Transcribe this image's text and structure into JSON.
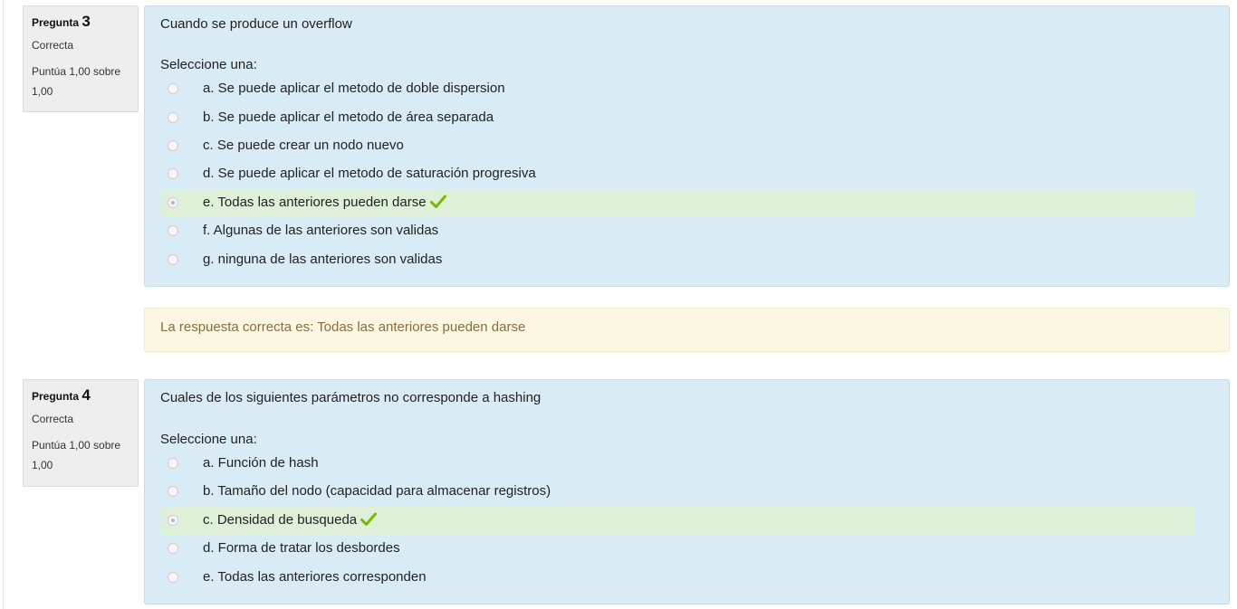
{
  "questions": [
    {
      "qlabel": "Pregunta",
      "number": "3",
      "state": "Correcta",
      "grade": "Puntúa 1,00 sobre 1,00",
      "text": "Cuando se produce un overflow",
      "prompt": "Seleccione una:",
      "answers": [
        {
          "label": "a. Se puede aplicar el metodo de doble dispersion",
          "selected": false,
          "correct": false
        },
        {
          "label": "b. Se puede aplicar el metodo de área separada",
          "selected": false,
          "correct": false
        },
        {
          "label": "c. Se puede crear un nodo nuevo",
          "selected": false,
          "correct": false
        },
        {
          "label": "d. Se puede aplicar el metodo de saturación progresiva",
          "selected": false,
          "correct": false
        },
        {
          "label": "e. Todas las anteriores pueden darse",
          "selected": true,
          "correct": true
        },
        {
          "label": "f. Algunas de las anteriores son validas",
          "selected": false,
          "correct": false
        },
        {
          "label": "g. ninguna de las anteriores son validas",
          "selected": false,
          "correct": false
        }
      ],
      "feedback": "La respuesta correcta es: Todas las anteriores pueden darse"
    },
    {
      "qlabel": "Pregunta",
      "number": "4",
      "state": "Correcta",
      "grade": "Puntúa 1,00 sobre 1,00",
      "text": "Cuales de los siguientes parámetros no corresponde a hashing",
      "prompt": "Seleccione una:",
      "answers": [
        {
          "label": "a. Función de hash",
          "selected": false,
          "correct": false
        },
        {
          "label": "b. Tamaño del nodo (capacidad para almacenar registros)",
          "selected": false,
          "correct": false
        },
        {
          "label": "c. Densidad de busqueda",
          "selected": true,
          "correct": true
        },
        {
          "label": "d. Forma de tratar los desbordes",
          "selected": false,
          "correct": false
        },
        {
          "label": "e. Todas las anteriores corresponden",
          "selected": false,
          "correct": false
        }
      ]
    }
  ],
  "colors": {
    "check": "#7ab800",
    "correct_bg": "#dff0d8",
    "formulation_bg": "#d9ebf5",
    "feedback_bg": "#fcf7e2"
  },
  "icons": {
    "correct": "check-icon"
  }
}
